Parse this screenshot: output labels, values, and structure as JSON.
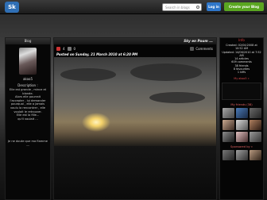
{
  "topbar": {
    "logo": "Sk",
    "search_placeholder": "Search in blogs",
    "login": "Log in",
    "create": "Create your Blog"
  },
  "left": {
    "header": "Blog",
    "username": "akoo5",
    "description_title": "Description :",
    "description": [
      "Elle est grande , mince et",
      "blonde.",
      "Alors elle pourrait",
      "l'accepter , lui demander",
      "pourquoi , elle a jamais",
      "voulu la rencontrer , elle",
      "voulait le retrouver.",
      "Elle est la fille...",
      "qu'il voulait ..."
    ],
    "description2": [
      "Je ne doute que ma flamme",
      "...."
    ]
  },
  "post": {
    "title": "Sky en Poum ...",
    "views": "4",
    "likes": "0",
    "comments": "Comments",
    "posted": "Posted on Sunday, 21 March 2010 at 6:20 PM"
  },
  "right": {
    "header": "Info",
    "info": [
      "Created: 02/04/2008 at 10:52 AM",
      "Updated: 14/06/2010 at 7:52 AM",
      "14 articles",
      "609 comments",
      "38 friends",
      "8 favourites",
      "1 kiffs"
    ],
    "link": "My akoo5 »",
    "friends_title": "My friends (38)",
    "sponsor_title": "Sponsored by »"
  },
  "colors": {
    "accent_blue": "#2e76c9",
    "accent_green": "#5aa621",
    "link_red": "#d84c4c"
  }
}
